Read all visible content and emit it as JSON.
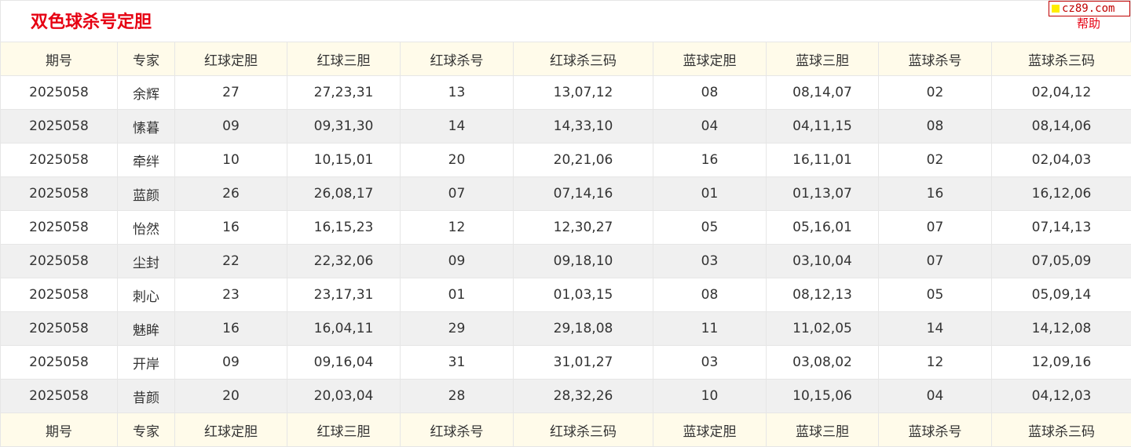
{
  "page_title": "双色球杀号定胆",
  "watermark": "cz89.com",
  "help_label": "帮助",
  "columns": [
    "期号",
    "专家",
    "红球定胆",
    "红球三胆",
    "红球杀号",
    "红球杀三码",
    "蓝球定胆",
    "蓝球三胆",
    "蓝球杀号",
    "蓝球杀三码"
  ],
  "rows": [
    [
      "2025058",
      "余辉",
      "27",
      "27,23,31",
      "13",
      "13,07,12",
      "08",
      "08,14,07",
      "02",
      "02,04,12"
    ],
    [
      "2025058",
      "愫暮",
      "09",
      "09,31,30",
      "14",
      "14,33,10",
      "04",
      "04,11,15",
      "08",
      "08,14,06"
    ],
    [
      "2025058",
      "牵绊",
      "10",
      "10,15,01",
      "20",
      "20,21,06",
      "16",
      "16,11,01",
      "02",
      "02,04,03"
    ],
    [
      "2025058",
      "蓝颜",
      "26",
      "26,08,17",
      "07",
      "07,14,16",
      "01",
      "01,13,07",
      "16",
      "16,12,06"
    ],
    [
      "2025058",
      "怡然",
      "16",
      "16,15,23",
      "12",
      "12,30,27",
      "05",
      "05,16,01",
      "07",
      "07,14,13"
    ],
    [
      "2025058",
      "尘封",
      "22",
      "22,32,06",
      "09",
      "09,18,10",
      "03",
      "03,10,04",
      "07",
      "07,05,09"
    ],
    [
      "2025058",
      "刺心",
      "23",
      "23,17,31",
      "01",
      "01,03,15",
      "08",
      "08,12,13",
      "05",
      "05,09,14"
    ],
    [
      "2025058",
      "魅眸",
      "16",
      "16,04,11",
      "29",
      "29,18,08",
      "11",
      "11,02,05",
      "14",
      "14,12,08"
    ],
    [
      "2025058",
      "开岸",
      "09",
      "09,16,04",
      "31",
      "31,01,27",
      "03",
      "03,08,02",
      "12",
      "12,09,16"
    ],
    [
      "2025058",
      "昔颜",
      "20",
      "20,03,04",
      "28",
      "28,32,26",
      "10",
      "10,15,06",
      "04",
      "04,12,03"
    ]
  ],
  "colors": {
    "title": "#e60012",
    "header_bg": "#fffbea",
    "row_alt_bg": "#f0f0f0",
    "border": "#e6e6e6",
    "watermark": "#c00000"
  }
}
